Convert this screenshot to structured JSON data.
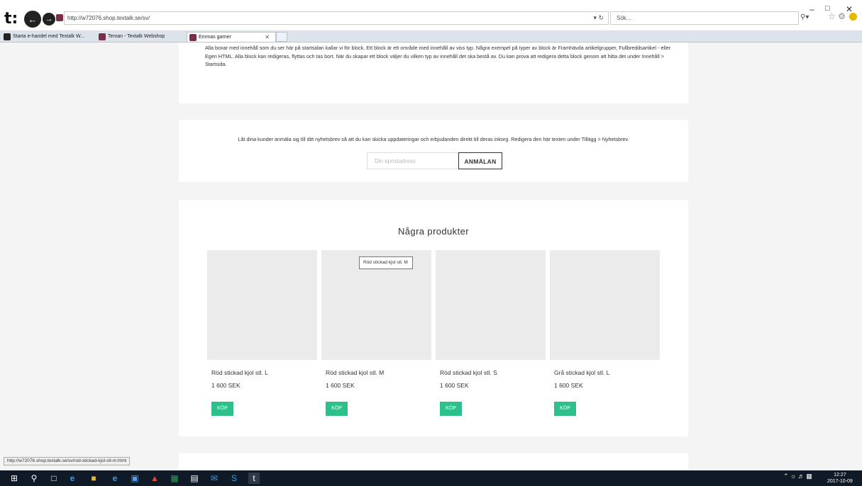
{
  "browser": {
    "url": "http://w72076.shop.textalk.se/sv/",
    "search_placeholder": "Sök...",
    "tabs": [
      {
        "label": "Starta e-handel med Textalk W..."
      },
      {
        "label": "Teman - Textalk Webshop"
      },
      {
        "label": "Emmas garner"
      }
    ],
    "status_url": "http://w72076.shop.textalk.se/sv/rod-stickad-kjol-stl-m.html"
  },
  "intro_block": {
    "text": "Alla boxar med innehåll som du ser här på startsidan kallar vi för block. Ett block är ett område med innehåll av viss typ. Några exempel på typer av block är Framhävda artikelgrupper, Fullbreddsartikel - eller Egen HTML. Alla block kan redigeras, flyttas och tas bort. När du skapar ett block väljer du vilken typ av innehåll det ska bestå av. Du kan prova att redigera detta block genom att hitta det under Innehåll > Startsida."
  },
  "newsletter": {
    "text": "Låt dina kunder anmäla sig till ditt nyhetsbrev så att du kan skicka uppdateringar och erbjudanden direkt till deras inkorg. Redigera den här texten under Tillägg > Nyhetsbrev.",
    "email_placeholder": "Din epostadress",
    "signup_label": "ANMÄLAN"
  },
  "products": {
    "heading": "Några produkter",
    "items": [
      {
        "name": "Röd stickad kjol stl. L",
        "price": "1 600 SEK",
        "buy_label": "KÖP"
      },
      {
        "name": "Röd stickad kjol stl. M",
        "price": "1 600 SEK",
        "buy_label": "KÖP"
      },
      {
        "name": "Röd stickad kjol stl. S",
        "price": "1 600 SEK",
        "buy_label": "KÖP"
      },
      {
        "name": "Grå stickad kjol stl. L",
        "price": "1 600 SEK",
        "buy_label": "KÖP"
      }
    ],
    "tooltip": "Röd stickad kjol stl. M"
  },
  "taskbar": {
    "time": "12:27",
    "date": "2017-10-09"
  },
  "colors": {
    "buy_button": "#2ec08a",
    "page_bg": "#f4f4f4",
    "taskbar": "#0f1a26"
  }
}
